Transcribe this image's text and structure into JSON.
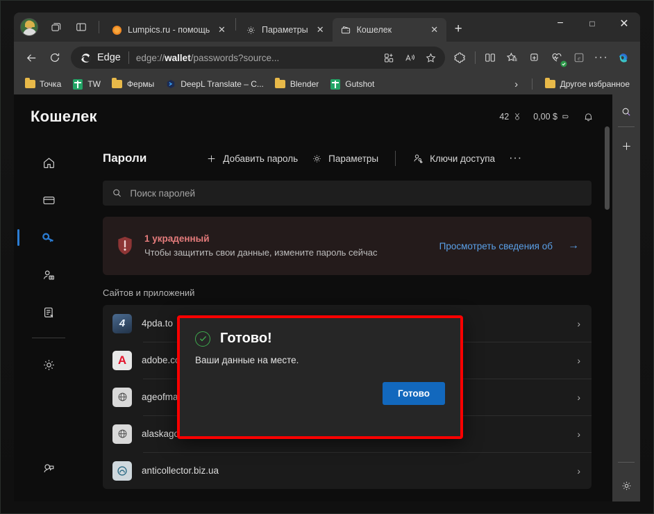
{
  "window": {
    "minimize": "−",
    "maximize": "□",
    "close": "✕"
  },
  "titlebar": {
    "profile_icon": "avatar-icon",
    "workspaces_icon": "workspaces-icon",
    "tab_actions_icon": "tab-actions-icon",
    "new_tab_label": "+",
    "tabs": [
      {
        "title": "Lumpics.ru - помощь с...",
        "favicon": "orange-icon",
        "active": false,
        "close": "✕"
      },
      {
        "title": "Параметры",
        "favicon": "gear-icon",
        "active": false,
        "close": "✕"
      },
      {
        "title": "Кошелек",
        "favicon": "wallet-icon",
        "active": true,
        "close": "✕"
      }
    ]
  },
  "navbar": {
    "back_icon": "back-arrow-icon",
    "refresh_icon": "refresh-icon",
    "brand_label": "Edge",
    "url_prefix": "edge://",
    "url_bold": "wallet",
    "url_suffix": "/passwords?source...",
    "omnibox_icons": [
      "split-screen-add-icon",
      "read-aloud-icon",
      "favorite-star-icon"
    ],
    "toolbar_icons": [
      "extensions-icon",
      "split-screen-icon",
      "favorites-icon",
      "collections-icon",
      "browser-essentials-icon",
      "ie-mode-icon",
      "settings-more-icon",
      "copilot-icon"
    ]
  },
  "bookmarks": {
    "items": [
      {
        "label": "Точка",
        "icon": "folder-icon"
      },
      {
        "label": "TW",
        "icon": "sheets-icon"
      },
      {
        "label": "Фермы",
        "icon": "folder-icon"
      },
      {
        "label": "DeepL Translate – C...",
        "icon": "deepl-icon"
      },
      {
        "label": "Blender",
        "icon": "folder-icon"
      },
      {
        "label": "Gutshot",
        "icon": "sheets-icon"
      }
    ],
    "overflow_chevron": "›",
    "other_favorites": {
      "label": "Другое избранное",
      "icon": "folder-icon"
    }
  },
  "edge_sidebar": {
    "search_icon": "search-icon",
    "add_icon": "plus-icon",
    "settings_icon": "gear-icon"
  },
  "wallet": {
    "title": "Кошелек",
    "header_stats": {
      "rewards_points": "42",
      "rewards_icon": "rewards-medal-icon",
      "cashback": "0,00 $",
      "cashback_icon": "tag-icon",
      "notifications_icon": "bell-icon"
    },
    "rail": [
      {
        "name": "home",
        "icon": "home-icon",
        "active": false
      },
      {
        "name": "cards",
        "icon": "credit-card-icon",
        "active": false
      },
      {
        "name": "passwords",
        "icon": "key-icon",
        "active": true
      },
      {
        "name": "personal-info",
        "icon": "person-card-icon",
        "active": false
      },
      {
        "name": "documents",
        "icon": "document-icon",
        "active": false
      },
      {
        "name": "settings",
        "icon": "gear-icon",
        "active": false
      },
      {
        "name": "feedback",
        "icon": "feedback-icon",
        "active": false
      }
    ],
    "passwords": {
      "heading": "Пароли",
      "commands": [
        {
          "label": "Добавить пароль",
          "icon": "plus-icon"
        },
        {
          "label": "Параметры",
          "icon": "gear-icon"
        },
        {
          "label": "Ключи доступа",
          "icon": "passkey-icon"
        }
      ],
      "more_label": "···",
      "search_placeholder": "Поиск паролей",
      "search_value": "",
      "search_icon": "search-icon"
    },
    "alert": {
      "icon": "shield-warning-icon",
      "title": "1 украденный",
      "body": "Чтобы защитить свои данные, измените пароль сейчас",
      "link": "Просмотреть сведения об",
      "link_arrow": "→"
    },
    "section_label": "Сайтов и приложений",
    "list": [
      {
        "name": "4pda.to",
        "favicon": "4pda-icon",
        "chevron": "›"
      },
      {
        "name": "adobe.com",
        "favicon": "adobe-icon",
        "chevron": "›"
      },
      {
        "name": "ageofmars.io",
        "favicon": "globe-icon",
        "chevron": "›"
      },
      {
        "name": "alaskagoldrush.io",
        "favicon": "globe-icon",
        "chevron": "›"
      },
      {
        "name": "anticollector.biz.ua",
        "favicon": "globe-blue-icon",
        "chevron": "›"
      }
    ]
  },
  "dialog": {
    "icon": "success-check-icon",
    "title": "Готово!",
    "message": "Ваши данные на месте.",
    "button_label": "Готово",
    "highlight_color": "#fb0000",
    "button_color": "#1268bd",
    "check_color": "#3faa4e"
  }
}
